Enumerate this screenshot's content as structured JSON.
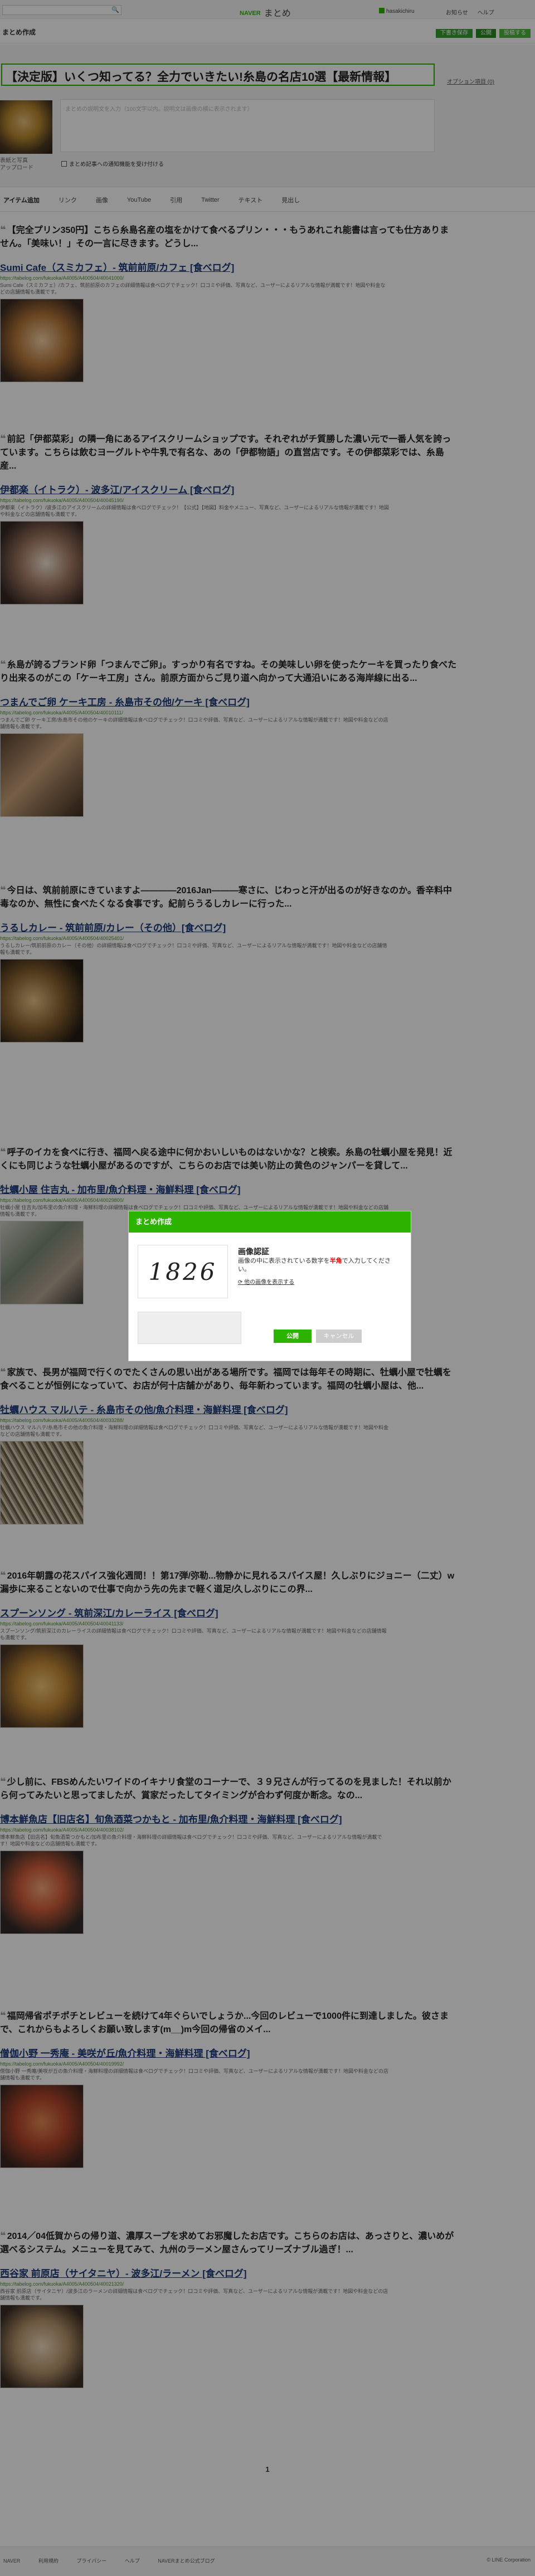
{
  "header": {
    "logo_brand": "NAVER",
    "logo_text": "まとめ",
    "user_name": "hasakichiru",
    "nav": [
      "お知らせ",
      "ヘルプ"
    ],
    "search_icon": "search-icon"
  },
  "subbar": {
    "create_label": "まとめ作成",
    "buttons": [
      "下書き保存",
      "公開",
      "投稿する"
    ]
  },
  "editor": {
    "title_value": "【決定版】いくつ知ってる？全力でいきたい!糸島の名店10選【最新情報】",
    "option_link": "オプション項目 (0)",
    "thumb_label": "表紙と写真\nアップロード",
    "desc_placeholder": "まとめの説明文を入力（100文字以内。説明文は画像の横に表示されます）",
    "notify_label": "まとめ記事への通知機能を受け付ける"
  },
  "tabs": [
    "アイテム追加",
    "リンク",
    "画像",
    "YouTube",
    "引用",
    "Twitter",
    "テキスト",
    "見出し"
  ],
  "items": [
    {
      "quote": "【完全プリン350円】こちら糸島名産の塩をかけて食べるプリン・・・もうあれこれ能書は言っても仕方ありません。「美味い！」その一言に尽きます。どうし...",
      "title": "Sumi Cafe（スミカフェ）- 筑前前原/カフェ [食べログ]",
      "url": "https://tabelog.com/fukuoka/A4005/A400504/40041000/",
      "desc": "Sumi Cafe（スミカフェ）/カフェ、筑前前原のカフェの詳細情報は食べログでチェック！口コミや評価、写真など、ユーザーによるリアルな情報が満載です！地図や料金などの店舗情報も満載です。"
    },
    {
      "quote": "前記「伊都菜彩」の隣一角にあるアイスクリームショップです。それぞれがチ質勝した濃い元で一番人気を誇っています。こちらは飲むヨーグルトや牛乳で有名な、あの「伊都物語」の直営店です。その伊都菜彩では、糸島産...",
      "title": "伊都楽（イトラク）- 波多江/アイスクリーム [食べログ]",
      "url": "https://tabelog.com/fukuoka/A4005/A400504/40045190/",
      "desc": "伊都楽（イトラク）/波多江のアイスクリームの詳細情報は食べログでチェック！【公式】【地図】料金やメニュー、写真など、ユーザーによるリアルな情報が満載です！地図や料金などの店舗情報も満載です。"
    },
    {
      "quote": "糸島が誇るブランド卵「つまんでご卵」。すっかり有名ですね。その美味しい卵を使ったケーキを買ったり食べたり出来るのがこの「ケーキ工房」さん。前原方面からご見り道へ向かって大通沿いにある海岸線に出る...",
      "title": "つまんでご卵 ケーキ工房 - 糸島市その他/ケーキ [食べログ]",
      "url": "https://tabelog.com/fukuoka/A4005/A400504/40010111/",
      "desc": "つまんでご卵 ケーキ工房/糸島市その他のケーキの詳細情報は食べログでチェック！口コミや評価、写真など、ユーザーによるリアルな情報が満載です！地図や料金などの店舗情報も満載です。"
    },
    {
      "quote": "今日は、筑前前原にきていますよ――――2016Jan―――寒さに、じわっと汗が出るのが好きなのか。香辛料中毒なのか、無性に食べたくなる食事です。紀前らうるしカレーに行った...",
      "title": "うるしカレー - 筑前前原/カレー（その他）[食べログ]",
      "url": "https://tabelog.com/fukuoka/A4005/A400504/40025401/",
      "desc": "うるしカレー/筑前前原のカレー（その他）の詳細情報は食べログでチェック！口コミや評価、写真など、ユーザーによるリアルな情報が満載です！地図や料金などの店舗情報も満載です。"
    },
    {
      "quote": "呼子のイカを食べに行き、福岡へ戻る途中に何かおいしいものはないかな？と検索。糸島の牡蠣小屋を発見！近くにも同じような牡蠣小屋があるのですが、こちらのお店では美い防止の黄色のジャンパーを貸して...",
      "title": "牡蠣小屋 住吉丸 - 加布里/魚介料理・海鮮料理 [食べログ]",
      "url": "https://tabelog.com/fukuoka/A4005/A400504/40029800/",
      "desc": "牡蠣小屋 住吉丸/加布里の魚介料理・海鮮料理の詳細情報は食べログでチェック！口コミや評価、写真など、ユーザーによるリアルな情報が満載です！地図や料金などの店舗情報も満載です。"
    },
    {
      "quote": "家族で、長男が福岡で行くのでたくさんの思い出がある場所です。福岡では毎年その時期に、牡蠣小屋で牡蠣を食べることが恒例になっていて、お店が何十店舗かがあり、毎年新わっています。福岡の牡蠣小屋は、他...",
      "title": "牡蠣ハウス マル八テ - 糸島市その他/魚介料理・海鮮料理 [食べログ]",
      "url": "https://tabelog.com/fukuoka/A4005/A400504/40033288/",
      "desc": "牡蠣ハウス マル八テ/糸島市その他の魚介料理・海鮮料理の詳細情報は食べログでチェック！口コミや評価、写真など、ユーザーによるリアルな情報が満載です！地図や料金などの店舗情報も満載です。"
    },
    {
      "quote": "2016年朝露の花スパイス強化週間！！第17弾/弥勒...物静かに見れるスパイス屋！久しぶりにジョニー（二丈）w漏歩に来ることないので仕事で向かう先の先まで軽く道足/久しぶりにこの界...",
      "title": "スプーンソング - 筑前深江/カレーライス [食べログ]",
      "url": "https://tabelog.com/fukuoka/A4005/A400504/40041133/",
      "desc": "スプーンソング/筑前深江のカレーライスの詳細情報は食べログでチェック！口コミや評価、写真など、ユーザーによるリアルな情報が満載です！地図や料金などの店舗情報も満載です。"
    },
    {
      "quote": "少し前に、FBSめんたいワイドのイキナリ食堂のコーナーで、３９兄さんが行ってるのを見ました！それ以前から何ってみたいと思ってましたが、賞家だったしてタイミングが合わず何度か断念。なの...",
      "title": "博本鮮魚店【旧店名】旬魚酒菜つかもと - 加布里/魚介料理・海鮮料理 [食べログ]",
      "url": "https://tabelog.com/fukuoka/A4005/A400504/40038102/",
      "desc": "博本鮮魚店【旧店名】旬魚酒菜つかもと/加布里の魚介料理・海鮮料理の詳細情報は食べログでチェック！口コミや評価、写真など、ユーザーによるリアルな情報が満載です！地図や料金などの店舗情報も満載です。"
    },
    {
      "quote": "福岡帰省ポチポチとレビューを続けて4年ぐらいでしょうか...今回のレビューで1000件に到達しました。彼さまで、これからもよろしくお願い致します(m__)m今回の帰省のメイ...",
      "title": "僧伽小野 一秀庵 - 美咲が丘/魚介料理・海鮮料理 [食べログ]",
      "url": "https://tabelog.com/fukuoka/A4005/A400504/40019992/",
      "desc": "僧伽小野 一秀庵/美咲が丘の魚介料理・海鮮料理の詳細情報は食べログでチェック！口コミや評価、写真など、ユーザーによるリアルな情報が満載です！地図や料金などの店舗情報も満載です。"
    },
    {
      "quote": "2014／04低賀からの帰り道、濃厚スープを求めてお邪魔したお店です。こちらのお店は、あっさりと、濃いめが選べるシステム。メニューを見てみて、九州のラーメン屋さんってリーズナブル過ぎ！...",
      "title": "西谷家 前原店（サイタニヤ）- 波多江/ラーメン [食べログ]",
      "url": "https://tabelog.com/fukuoka/A4005/A400504/40021320/",
      "desc": "西谷家 前原店（サイタニヤ）/波多江のラーメンの詳細情報は食べログでチェック！口コミや評価、写真など、ユーザーによるリアルな情報が満載です！地図や料金などの店舗情報も満載です。"
    }
  ],
  "pager": {
    "current": "1"
  },
  "footer": {
    "links": [
      "NAVER",
      "利用規約",
      "プライバシー",
      "ヘルプ",
      "NAVERまとめ公式ブログ"
    ],
    "copyright": "© LINE Corporation"
  },
  "modal": {
    "header": "まとめ作成",
    "captcha_text": "1826",
    "title": "画像認証",
    "inst_before": "画像の中に表示されている数字を",
    "inst_red": "半角",
    "inst_after": "で入力してください。",
    "refresh": "他の画像を表示する",
    "ok": "公開",
    "cancel": "キャンセル"
  }
}
